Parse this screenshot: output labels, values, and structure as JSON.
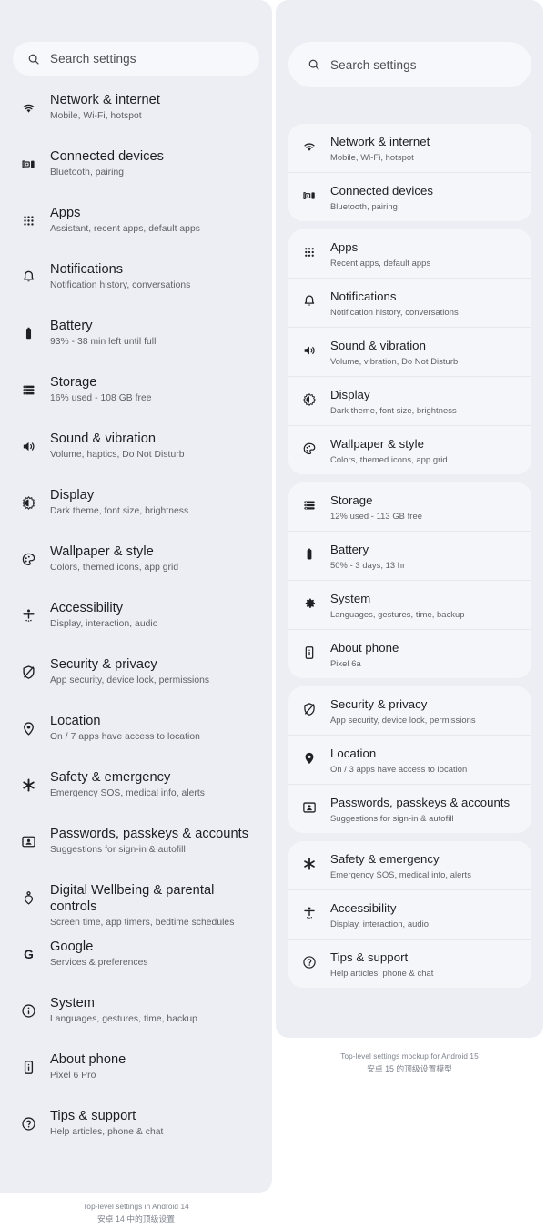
{
  "left_panel": {
    "name": "Android 14 top-level settings",
    "search": {
      "placeholder": "Search settings",
      "icon": "search-icon"
    },
    "items": [
      {
        "icon": "wifi-icon",
        "title": "Network & internet",
        "subtitle": "Mobile, Wi-Fi, hotspot"
      },
      {
        "icon": "connected-devices-icon",
        "title": "Connected devices",
        "subtitle": "Bluetooth, pairing"
      },
      {
        "icon": "apps-grid-icon",
        "title": "Apps",
        "subtitle": "Assistant, recent apps, default apps"
      },
      {
        "icon": "bell-icon",
        "title": "Notifications",
        "subtitle": "Notification history, conversations"
      },
      {
        "icon": "battery-icon",
        "title": "Battery",
        "subtitle": "93% - 38 min left until full"
      },
      {
        "icon": "storage-icon",
        "title": "Storage",
        "subtitle": "16% used - 108 GB free"
      },
      {
        "icon": "volume-icon",
        "title": "Sound & vibration",
        "subtitle": "Volume, haptics, Do Not Disturb"
      },
      {
        "icon": "display-brightness-icon",
        "title": "Display",
        "subtitle": "Dark theme, font size, brightness"
      },
      {
        "icon": "palette-icon",
        "title": "Wallpaper & style",
        "subtitle": "Colors, themed icons, app grid"
      },
      {
        "icon": "accessibility-icon",
        "title": "Accessibility",
        "subtitle": "Display, interaction, audio"
      },
      {
        "icon": "shield-icon",
        "title": "Security & privacy",
        "subtitle": "App security, device lock, permissions"
      },
      {
        "icon": "location-pin-icon",
        "title": "Location",
        "subtitle": "On / 7 apps have access to location"
      },
      {
        "icon": "asterisk-icon",
        "title": "Safety & emergency",
        "subtitle": "Emergency SOS, medical info, alerts"
      },
      {
        "icon": "passwords-icon",
        "title": "Passwords, passkeys & accounts",
        "subtitle": "Suggestions for sign-in & autofill"
      },
      {
        "icon": "wellbeing-icon",
        "title": "Digital Wellbeing & parental controls",
        "subtitle": "Screen time, app timers, bedtime schedules"
      },
      {
        "icon": "google-g-icon",
        "title": "Google",
        "subtitle": "Services & preferences"
      },
      {
        "icon": "info-circle-icon",
        "title": "System",
        "subtitle": "Languages, gestures, time, backup"
      },
      {
        "icon": "phone-info-icon",
        "title": "About phone",
        "subtitle": "Pixel 6 Pro"
      },
      {
        "icon": "help-circle-icon",
        "title": "Tips & support",
        "subtitle": "Help articles, phone & chat"
      }
    ],
    "caption_en": "Top-level settings in Android 14",
    "caption_zh": "安卓 14 中的顶级设置"
  },
  "right_panel": {
    "name": "Android 15 top-level settings mockup",
    "search": {
      "placeholder": "Search settings",
      "icon": "search-icon"
    },
    "groups": [
      {
        "items": [
          {
            "icon": "wifi-icon",
            "title": "Network & internet",
            "subtitle": "Mobile, Wi-Fi, hotspot"
          },
          {
            "icon": "connected-devices-icon",
            "title": "Connected devices",
            "subtitle": "Bluetooth, pairing"
          }
        ]
      },
      {
        "items": [
          {
            "icon": "apps-grid-icon",
            "title": "Apps",
            "subtitle": "Recent apps, default apps"
          },
          {
            "icon": "bell-icon",
            "title": "Notifications",
            "subtitle": "Notification history, conversations"
          },
          {
            "icon": "volume-icon",
            "title": "Sound & vibration",
            "subtitle": "Volume, vibration, Do Not Disturb"
          },
          {
            "icon": "display-brightness-icon",
            "title": "Display",
            "subtitle": "Dark theme, font size, brightness"
          },
          {
            "icon": "palette-icon",
            "title": "Wallpaper & style",
            "subtitle": "Colors, themed icons, app grid"
          }
        ]
      },
      {
        "items": [
          {
            "icon": "storage-icon",
            "title": "Storage",
            "subtitle": "12% used - 113 GB free"
          },
          {
            "icon": "battery-icon",
            "title": "Battery",
            "subtitle": "50% - 3 days, 13 hr"
          },
          {
            "icon": "gear-icon",
            "title": "System",
            "subtitle": "Languages, gestures, time, backup"
          },
          {
            "icon": "phone-info-icon",
            "title": "About phone",
            "subtitle": "Pixel 6a"
          }
        ]
      },
      {
        "items": [
          {
            "icon": "shield-icon",
            "title": "Security & privacy",
            "subtitle": "App security, device lock, permissions"
          },
          {
            "icon": "location-pin-icon",
            "title": "Location",
            "subtitle": "On / 3 apps have access to location"
          },
          {
            "icon": "passwords-icon",
            "title": "Passwords, passkeys & accounts",
            "subtitle": "Suggestions for sign-in & autofill"
          }
        ]
      },
      {
        "items": [
          {
            "icon": "asterisk-icon",
            "title": "Safety & emergency",
            "subtitle": "Emergency SOS, medical info, alerts"
          },
          {
            "icon": "accessibility-icon",
            "title": "Accessibility",
            "subtitle": "Display, interaction, audio"
          },
          {
            "icon": "help-circle-icon",
            "title": "Tips & support",
            "subtitle": "Help articles, phone & chat"
          }
        ]
      }
    ],
    "caption_en": "Top-level settings mockup for Android 15",
    "caption_zh": "安卓 15 的顶级设置模型"
  },
  "colors": {
    "panel_background": "#eceef4",
    "card_background": "#f5f6fa",
    "search_background": "#f7f8fb",
    "title_text": "#1d1e21",
    "subtitle_text": "#5d6166",
    "caption_text": "#7e838c"
  }
}
